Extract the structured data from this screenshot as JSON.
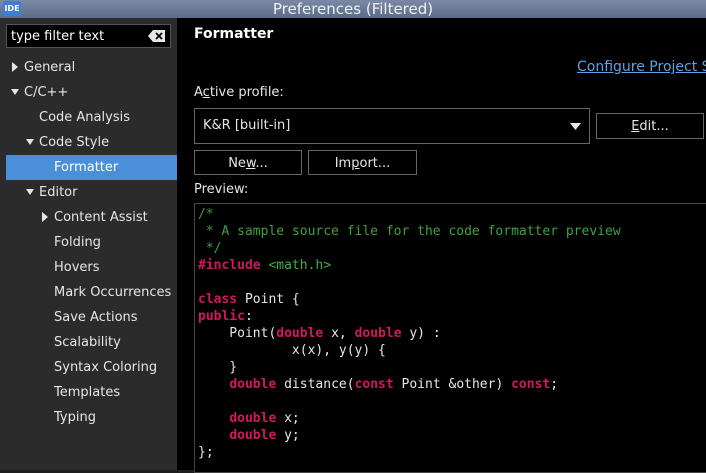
{
  "window": {
    "title": "Preferences (Filtered)",
    "icon_text": "IDE"
  },
  "sidebar": {
    "filter_placeholder": "type filter text",
    "tree": [
      {
        "label": "General",
        "twisty": "collapsed",
        "depth": 0
      },
      {
        "label": "C/C++",
        "twisty": "expanded",
        "depth": 0
      },
      {
        "label": "Code Analysis",
        "twisty": "none",
        "depth": 1
      },
      {
        "label": "Code Style",
        "twisty": "expanded",
        "depth": 1
      },
      {
        "label": "Formatter",
        "twisty": "none",
        "depth": 2,
        "selected": true
      },
      {
        "label": "Editor",
        "twisty": "expanded",
        "depth": 1
      },
      {
        "label": "Content Assist",
        "twisty": "collapsed",
        "depth": 2
      },
      {
        "label": "Folding",
        "twisty": "none",
        "depth": 2
      },
      {
        "label": "Hovers",
        "twisty": "none",
        "depth": 2
      },
      {
        "label": "Mark Occurrences",
        "twisty": "none",
        "depth": 2
      },
      {
        "label": "Save Actions",
        "twisty": "none",
        "depth": 2
      },
      {
        "label": "Scalability",
        "twisty": "none",
        "depth": 2
      },
      {
        "label": "Syntax Coloring",
        "twisty": "none",
        "depth": 2
      },
      {
        "label": "Templates",
        "twisty": "none",
        "depth": 2
      },
      {
        "label": "Typing",
        "twisty": "none",
        "depth": 2
      }
    ]
  },
  "main": {
    "title": "Formatter",
    "configure_link": "Configure Project S",
    "active_profile": {
      "label_pre": "A",
      "label_mnemonic": "c",
      "label_post": "tive profile:",
      "value": "K&R [built-in]"
    },
    "buttons": {
      "edit": {
        "pre": "",
        "mn": "E",
        "post": "dit..."
      },
      "new": {
        "pre": "Ne",
        "mn": "w",
        "post": "..."
      },
      "import": {
        "pre": "Im",
        "mn": "p",
        "post": "ort..."
      }
    },
    "preview_label": "Preview:",
    "preview_lines": [
      [
        {
          "t": "/*",
          "c": "cm"
        }
      ],
      [
        {
          "t": " * A sample source file for the code formatter preview",
          "c": "cm"
        }
      ],
      [
        {
          "t": " */",
          "c": "cm"
        }
      ],
      [
        {
          "t": "#include",
          "c": "inc"
        },
        {
          "t": " ",
          "c": ""
        },
        {
          "t": "<math.h>",
          "c": "hdr"
        }
      ],
      [],
      [
        {
          "t": "class",
          "c": "kw"
        },
        {
          "t": " Point {",
          "c": ""
        }
      ],
      [
        {
          "t": "public",
          "c": "kw"
        },
        {
          "t": ":",
          "c": ""
        }
      ],
      [
        {
          "t": "    Point(",
          "c": ""
        },
        {
          "t": "double",
          "c": "kw"
        },
        {
          "t": " x, ",
          "c": ""
        },
        {
          "t": "double",
          "c": "kw"
        },
        {
          "t": " y) :",
          "c": ""
        }
      ],
      [
        {
          "t": "            x(x), y(y) {",
          "c": ""
        }
      ],
      [
        {
          "t": "    }",
          "c": ""
        }
      ],
      [
        {
          "t": "    ",
          "c": ""
        },
        {
          "t": "double",
          "c": "kw"
        },
        {
          "t": " distance(",
          "c": ""
        },
        {
          "t": "const",
          "c": "kw"
        },
        {
          "t": " Point &other) ",
          "c": ""
        },
        {
          "t": "const",
          "c": "kw"
        },
        {
          "t": ";",
          "c": ""
        }
      ],
      [],
      [
        {
          "t": "    ",
          "c": ""
        },
        {
          "t": "double",
          "c": "kw"
        },
        {
          "t": " x;",
          "c": ""
        }
      ],
      [
        {
          "t": "    ",
          "c": ""
        },
        {
          "t": "double",
          "c": "kw"
        },
        {
          "t": " y;",
          "c": ""
        }
      ],
      [
        {
          "t": "};",
          "c": ""
        }
      ]
    ]
  },
  "colors": {
    "selection": "#4a90d9",
    "keyword": "#d0195c",
    "comment": "#3fa13f",
    "link": "#5aa3e6"
  }
}
